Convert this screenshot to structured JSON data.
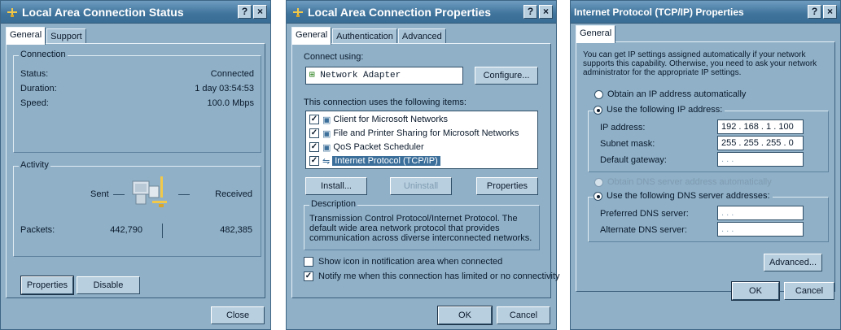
{
  "status_window": {
    "title": "Local Area Connection Status",
    "help_btn": "?",
    "close_btn": "×",
    "tabs": [
      {
        "label": "General"
      },
      {
        "label": "Support"
      }
    ],
    "connection_group": "Connection",
    "connection": [
      {
        "label": "Status:",
        "value": "Connected"
      },
      {
        "label": "Duration:",
        "value": "1 day 03:54:53"
      },
      {
        "label": "Speed:",
        "value": "100.0 Mbps"
      }
    ],
    "activity_group": "Activity",
    "sent_label": "Sent",
    "received_label": "Received",
    "packets_label": "Packets:",
    "packets_sent": "442,790",
    "packets_received": "482,385",
    "properties_btn": "Properties",
    "disable_btn": "Disable",
    "close_label": "Close"
  },
  "properties_window": {
    "title": "Local Area Connection Properties",
    "help_btn": "?",
    "close_btn": "×",
    "tabs": [
      {
        "label": "General"
      },
      {
        "label": "Authentication"
      },
      {
        "label": "Advanced"
      }
    ],
    "connect_using_label": "Connect using:",
    "adapter_name": "Network Adapter",
    "configure_btn": "Configure...",
    "items_label": "This connection uses the following items:",
    "items": [
      {
        "label": "Client for Microsoft Networks",
        "checked": true
      },
      {
        "label": "File and Printer Sharing for Microsoft Networks",
        "checked": true
      },
      {
        "label": "QoS Packet Scheduler",
        "checked": true
      },
      {
        "label": "Internet Protocol (TCP/IP)",
        "checked": true
      }
    ],
    "check_mark": "✓",
    "install_btn": "Install...",
    "uninstall_btn": "Uninstall",
    "properties_btn": "Properties",
    "description_group": "Description",
    "description_text": "Transmission Control Protocol/Internet Protocol. The default wide area network protocol that provides communication across diverse interconnected networks.",
    "show_icon_label": "Show icon in notification area when connected",
    "notify_label": "Notify me when this connection has limited or no connectivity",
    "ok_btn": "OK",
    "cancel_btn": "Cancel"
  },
  "tcpip_window": {
    "title": "Internet Protocol (TCP/IP) Properties",
    "help_btn": "?",
    "close_btn": "×",
    "tabs": [
      {
        "label": "General"
      }
    ],
    "intro_text": "You can get IP settings assigned automatically if your network supports this capability. Otherwise, you need to ask your network administrator for the appropriate IP settings.",
    "obtain_ip_auto": "Obtain an IP address automatically",
    "use_following_ip": "Use the following IP address:",
    "ip_address_label": "IP address:",
    "ip_address_value": "192 . 168 . 1 . 100",
    "subnet_label": "Subnet mask:",
    "subnet_value": "255 . 255 . 255 . 0",
    "gateway_label": "Default gateway:",
    "gateway_value": ".       .       .",
    "obtain_dns_auto": "Obtain DNS server address automatically",
    "use_following_dns": "Use the following DNS server addresses:",
    "preferred_dns_label": "Preferred DNS server:",
    "preferred_dns_value": ".       .       .",
    "alternate_dns_label": "Alternate DNS server:",
    "alternate_dns_value": ".       .       .",
    "advanced_btn": "Advanced...",
    "ok_btn": "OK",
    "cancel_btn": "Cancel"
  }
}
